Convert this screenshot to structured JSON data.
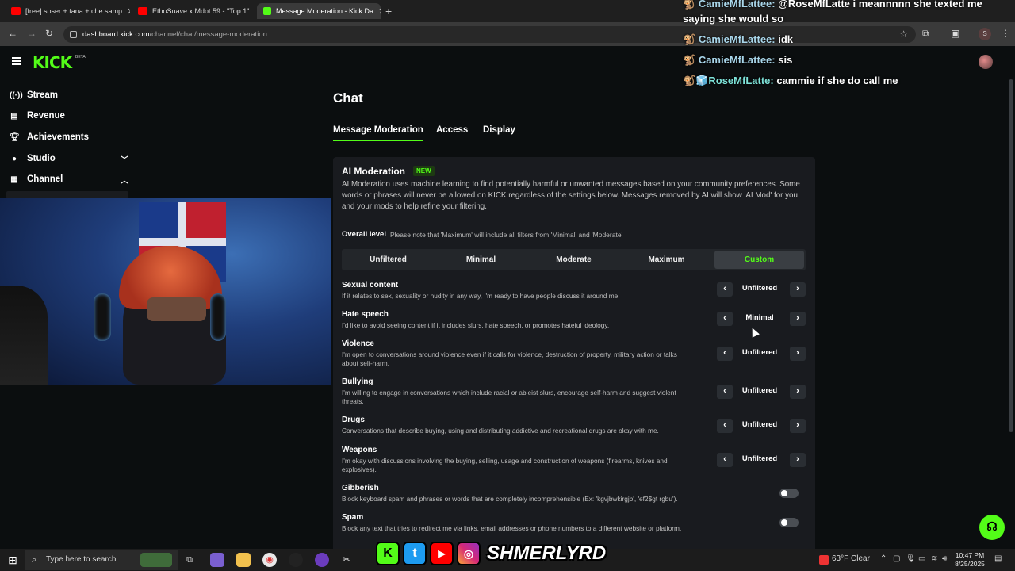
{
  "browser": {
    "tabs": [
      {
        "title": "[free] soser + tana + che samp",
        "icon": "youtube-icon",
        "color": "#ff0000"
      },
      {
        "title": "EthoSuave x Mdot 59 - \"Top 1\"",
        "icon": "youtube-icon",
        "color": "#ff0000"
      },
      {
        "title": "Message Moderation - Kick Da",
        "icon": "kick-icon",
        "color": "#53fc18"
      }
    ],
    "url_host": "dashboard.kick.com",
    "url_path": "/channel/chat/message-moderation",
    "profile_letter": "S"
  },
  "sidebar": {
    "items": [
      {
        "label": "Stream",
        "icon": "broadcast-icon"
      },
      {
        "label": "Revenue",
        "icon": "revenue-icon"
      },
      {
        "label": "Achievements",
        "icon": "trophy-icon"
      },
      {
        "label": "Studio",
        "icon": "studio-icon"
      },
      {
        "label": "Channel",
        "icon": "channel-icon"
      }
    ]
  },
  "logo_text": "KICK",
  "logo_badge": "BETA",
  "page": {
    "title": "Chat",
    "tabs": [
      "Message Moderation",
      "Access",
      "Display"
    ]
  },
  "ai": {
    "title": "AI Moderation",
    "badge": "NEW",
    "description": "AI Moderation uses machine learning to find potentially harmful or unwanted messages based on your community preferences. Some words or phrases will never be allowed on KICK regardless of the settings below. Messages removed by AI will show 'AI Mod' for you and your mods to help refine your filtering.",
    "overall_label": "Overall level",
    "overall_note": "Please note that 'Maximum' will include all filters from 'Minimal' and 'Moderate'",
    "levels": [
      "Unfiltered",
      "Minimal",
      "Moderate",
      "Maximum",
      "Custom"
    ],
    "selected_level": "Custom",
    "categories": [
      {
        "title": "Sexual content",
        "desc": "If it relates to sex, sexuality or nudity in any way, I'm ready to have people discuss it around me.",
        "value": "Unfiltered"
      },
      {
        "title": "Hate speech",
        "desc": "I'd like to avoid seeing content if it includes slurs, hate speech, or promotes hateful ideology.",
        "value": "Minimal"
      },
      {
        "title": "Violence",
        "desc": "I'm open to conversations around violence even if it calls for violence, destruction of property, military action or talks about self-harm.",
        "value": "Unfiltered"
      },
      {
        "title": "Bullying",
        "desc": "I'm willing to engage in conversations which include racial or ableist slurs, encourage self-harm and suggest violent threats.",
        "value": "Unfiltered"
      },
      {
        "title": "Drugs",
        "desc": "Conversations that describe buying, using and distributing addictive and recreational drugs are okay with me.",
        "value": "Unfiltered"
      },
      {
        "title": "Weapons",
        "desc": "I'm okay with discussions involving the buying, selling, usage and construction of weapons (firearms, knives and explosives).",
        "value": "Unfiltered"
      }
    ],
    "toggles": [
      {
        "title": "Gibberish",
        "desc": "Block keyboard spam and phrases or words that are completely incomprehensible (Ex: 'kgvjbwkirgjb', 'ef2$gt rgbu').",
        "on": false
      },
      {
        "title": "Spam",
        "desc": "Block any text that tries to redirect me via links, email addresses or phone numbers to a different website or platform.",
        "on": false
      }
    ]
  },
  "chat_overlay": [
    {
      "user": "CamieMfLattee:",
      "text": "@RoseMfLatte i meannnnn she texted me"
    },
    {
      "user": "",
      "text": "saying she would so"
    },
    {
      "user": "CamieMfLattee:",
      "text": "idk"
    },
    {
      "user": "CamieMfLattee:",
      "text": "sis"
    },
    {
      "user": "RoseMfLatte:",
      "text": "cammie if she do call me"
    }
  ],
  "stream_overlay": {
    "handle": "SHMERLYRD"
  },
  "taskbar": {
    "search_placeholder": "Type here to search",
    "weather": "63°F  Clear",
    "time": "10:47 PM",
    "date": "8/25/2025"
  },
  "colors": {
    "accent": "#53fc18",
    "background": "#0b0e0f",
    "card": "#191b1f"
  }
}
